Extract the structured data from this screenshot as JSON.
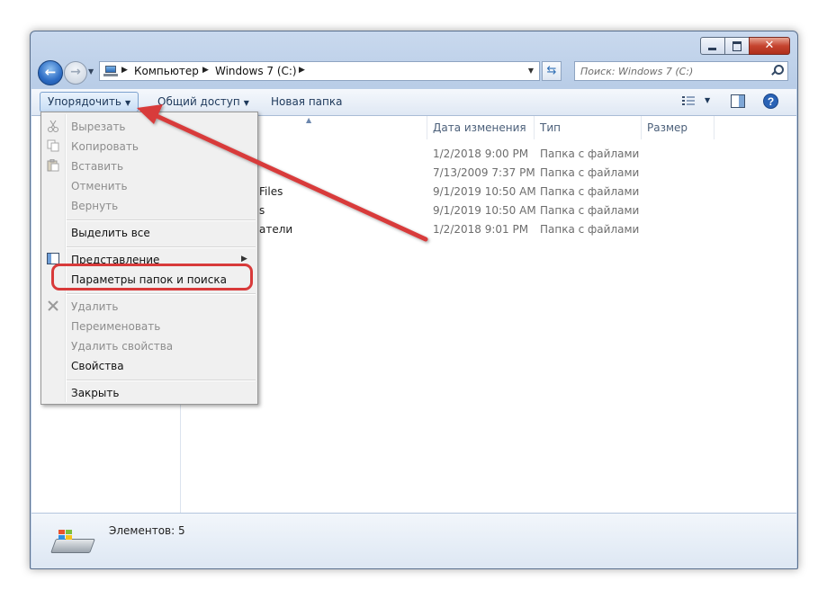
{
  "window": {
    "address": {
      "crumbs": [
        "Компьютер",
        "Windows 7 (C:)"
      ]
    },
    "search": {
      "placeholder": "Поиск: Windows 7 (C:)"
    },
    "toolbar": {
      "organize": "Упорядочить",
      "share": "Общий доступ",
      "new_folder": "Новая папка"
    },
    "columns": {
      "name": "",
      "date": "Дата изменения",
      "type": "Тип",
      "size": "Размер"
    },
    "files": [
      {
        "name": "",
        "date": "1/2/2018 9:00 PM",
        "type": "Папка с файлами"
      },
      {
        "name": "",
        "date": "7/13/2009 7:37 PM",
        "type": "Папка с файлами"
      },
      {
        "name": "Files",
        "date": "9/1/2019 10:50 AM",
        "type": "Папка с файлами"
      },
      {
        "name": "s",
        "date": "9/1/2019 10:50 AM",
        "type": "Папка с файлами"
      },
      {
        "name": "атели",
        "date": "1/2/2018 9:01 PM",
        "type": "Папка с файлами"
      }
    ],
    "status": {
      "text": "Элементов: 5"
    }
  },
  "menu": {
    "items": [
      {
        "label": "Вырезать",
        "enabled": false,
        "icon": "scissors-icon"
      },
      {
        "label": "Копировать",
        "enabled": false,
        "icon": "copy-icon"
      },
      {
        "label": "Вставить",
        "enabled": false,
        "icon": "paste-icon"
      },
      {
        "label": "Отменить",
        "enabled": false
      },
      {
        "label": "Вернуть",
        "enabled": false
      },
      {
        "label": "Выделить все",
        "enabled": true
      },
      {
        "label": "Представление",
        "enabled": true,
        "submenu": true,
        "icon": "layout-icon"
      },
      {
        "label": "Параметры папок и поиска",
        "enabled": true,
        "highlighted": true
      },
      {
        "label": "Удалить",
        "enabled": false,
        "icon": "delete-x-icon"
      },
      {
        "label": "Переименовать",
        "enabled": false
      },
      {
        "label": "Удалить свойства",
        "enabled": false
      },
      {
        "label": "Свойства",
        "enabled": true
      },
      {
        "label": "Закрыть",
        "enabled": true
      }
    ]
  },
  "colors": {
    "annotation": "#d83a3a",
    "accent": "#1e395b"
  }
}
